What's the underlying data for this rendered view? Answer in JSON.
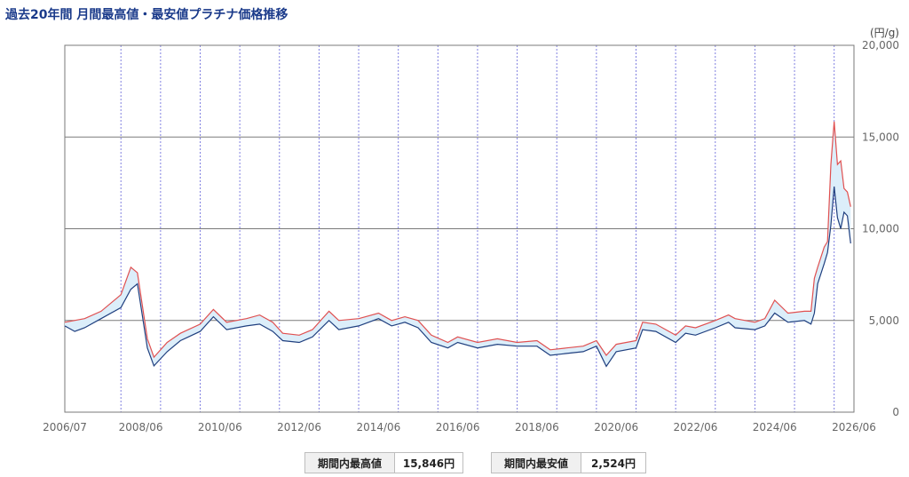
{
  "title": "過去20年間 月間最高値・最安値プラチナ価格推移",
  "unit_label": "(円/g)",
  "summary": {
    "max_label": "期間内最高値",
    "max_value": "15,846円",
    "min_label": "期間内最安値",
    "min_value": "2,524円"
  },
  "colors": {
    "high_line": "#e05050",
    "low_line": "#1f3f7f",
    "band_fill": "#dceefa",
    "grid_major": "#7a7a7a",
    "grid_minor": "#8080e0",
    "title": "#1a3a8a"
  },
  "chart_data": {
    "type": "area",
    "title": "過去20年間 月間最高値・最安値プラチナ価格推移",
    "ylabel": "(円/g)",
    "xlabel": "",
    "ylim": [
      0,
      20000
    ],
    "xlim": [
      "2006/07",
      "2026/06"
    ],
    "yticks": [
      "0",
      "5,000",
      "10,000",
      "15,000",
      "20,000"
    ],
    "xticks": [
      "2006/07",
      "2008/06",
      "2010/06",
      "2012/06",
      "2014/06",
      "2016/06",
      "2018/06",
      "2020/06",
      "2022/06",
      "2024/06",
      "2026/06"
    ],
    "grid": true,
    "series": [
      {
        "key": "high",
        "points": [
          [
            "2006/07",
            4900
          ],
          [
            "2007/01",
            5100
          ],
          [
            "2007/06",
            5500
          ],
          [
            "2007/12",
            6400
          ],
          [
            "2008/03",
            7900
          ],
          [
            "2008/05",
            7600
          ],
          [
            "2008/08",
            4000
          ],
          [
            "2008/10",
            3000
          ],
          [
            "2009/02",
            3800
          ],
          [
            "2009/06",
            4300
          ],
          [
            "2009/12",
            4800
          ],
          [
            "2010/04",
            5600
          ],
          [
            "2010/08",
            4900
          ],
          [
            "2011/02",
            5100
          ],
          [
            "2011/06",
            5300
          ],
          [
            "2011/10",
            4900
          ],
          [
            "2012/01",
            4300
          ],
          [
            "2012/06",
            4200
          ],
          [
            "2012/10",
            4500
          ],
          [
            "2013/03",
            5500
          ],
          [
            "2013/06",
            5000
          ],
          [
            "2013/12",
            5100
          ],
          [
            "2014/06",
            5400
          ],
          [
            "2014/10",
            5000
          ],
          [
            "2015/02",
            5200
          ],
          [
            "2015/06",
            5000
          ],
          [
            "2015/10",
            4200
          ],
          [
            "2016/03",
            3800
          ],
          [
            "2016/06",
            4100
          ],
          [
            "2016/12",
            3800
          ],
          [
            "2017/06",
            4000
          ],
          [
            "2017/12",
            3800
          ],
          [
            "2018/06",
            3900
          ],
          [
            "2018/10",
            3400
          ],
          [
            "2019/03",
            3500
          ],
          [
            "2019/08",
            3600
          ],
          [
            "2019/12",
            3900
          ],
          [
            "2020/03",
            3100
          ],
          [
            "2020/06",
            3700
          ],
          [
            "2020/12",
            3900
          ],
          [
            "2021/02",
            4900
          ],
          [
            "2021/06",
            4800
          ],
          [
            "2021/12",
            4200
          ],
          [
            "2022/03",
            4700
          ],
          [
            "2022/06",
            4600
          ],
          [
            "2022/12",
            5000
          ],
          [
            "2023/04",
            5300
          ],
          [
            "2023/06",
            5100
          ],
          [
            "2023/12",
            4900
          ],
          [
            "2024/03",
            5100
          ],
          [
            "2024/06",
            6100
          ],
          [
            "2024/10",
            5400
          ],
          [
            "2025/03",
            5500
          ],
          [
            "2025/05",
            5500
          ],
          [
            "2025/06",
            7300
          ],
          [
            "2025/07",
            7900
          ],
          [
            "2025/09",
            9000
          ],
          [
            "2025/10",
            9300
          ],
          [
            "2025/11",
            13500
          ],
          [
            "2025/12",
            15846
          ],
          [
            "2026/01",
            13500
          ],
          [
            "2026/02",
            13700
          ],
          [
            "2026/03",
            12200
          ],
          [
            "2026/04",
            12000
          ],
          [
            "2026/05",
            11200
          ]
        ]
      },
      {
        "key": "low",
        "points": [
          [
            "2006/07",
            4700
          ],
          [
            "2006/10",
            4400
          ],
          [
            "2007/01",
            4600
          ],
          [
            "2007/06",
            5100
          ],
          [
            "2007/12",
            5700
          ],
          [
            "2008/03",
            6700
          ],
          [
            "2008/05",
            7000
          ],
          [
            "2008/08",
            3500
          ],
          [
            "2008/10",
            2524
          ],
          [
            "2009/02",
            3300
          ],
          [
            "2009/06",
            3900
          ],
          [
            "2009/12",
            4400
          ],
          [
            "2010/04",
            5200
          ],
          [
            "2010/08",
            4500
          ],
          [
            "2011/02",
            4700
          ],
          [
            "2011/06",
            4800
          ],
          [
            "2011/10",
            4400
          ],
          [
            "2012/01",
            3900
          ],
          [
            "2012/06",
            3800
          ],
          [
            "2012/10",
            4100
          ],
          [
            "2013/03",
            5000
          ],
          [
            "2013/06",
            4500
          ],
          [
            "2013/12",
            4700
          ],
          [
            "2014/06",
            5100
          ],
          [
            "2014/10",
            4700
          ],
          [
            "2015/02",
            4900
          ],
          [
            "2015/06",
            4600
          ],
          [
            "2015/10",
            3800
          ],
          [
            "2016/03",
            3500
          ],
          [
            "2016/06",
            3800
          ],
          [
            "2016/12",
            3500
          ],
          [
            "2017/06",
            3700
          ],
          [
            "2017/12",
            3600
          ],
          [
            "2018/06",
            3600
          ],
          [
            "2018/10",
            3100
          ],
          [
            "2019/03",
            3200
          ],
          [
            "2019/08",
            3300
          ],
          [
            "2019/12",
            3600
          ],
          [
            "2020/03",
            2500
          ],
          [
            "2020/06",
            3300
          ],
          [
            "2020/12",
            3500
          ],
          [
            "2021/02",
            4500
          ],
          [
            "2021/06",
            4400
          ],
          [
            "2021/12",
            3800
          ],
          [
            "2022/03",
            4300
          ],
          [
            "2022/06",
            4200
          ],
          [
            "2022/12",
            4600
          ],
          [
            "2023/04",
            4900
          ],
          [
            "2023/06",
            4600
          ],
          [
            "2023/12",
            4500
          ],
          [
            "2024/03",
            4700
          ],
          [
            "2024/06",
            5400
          ],
          [
            "2024/10",
            4900
          ],
          [
            "2025/03",
            5000
          ],
          [
            "2025/05",
            4800
          ],
          [
            "2025/06",
            5400
          ],
          [
            "2025/07",
            7000
          ],
          [
            "2025/09",
            8100
          ],
          [
            "2025/10",
            8700
          ],
          [
            "2025/11",
            10200
          ],
          [
            "2025/12",
            12300
          ],
          [
            "2026/01",
            10600
          ],
          [
            "2026/02",
            10000
          ],
          [
            "2026/03",
            10900
          ],
          [
            "2026/04",
            10700
          ],
          [
            "2026/05",
            9200
          ]
        ]
      }
    ]
  }
}
